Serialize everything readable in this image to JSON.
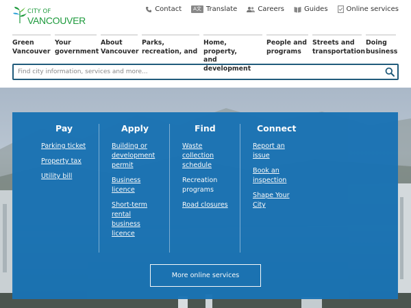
{
  "logo": {
    "line1": "CITY OF",
    "line2": "VANCOUVER"
  },
  "utility": [
    {
      "label": "Contact",
      "icon": "phone-icon"
    },
    {
      "label": "Translate",
      "icon": "translate-icon",
      "badge": "A文"
    },
    {
      "label": "Careers",
      "icon": "people-icon"
    },
    {
      "label": "Guides",
      "icon": "book-icon"
    },
    {
      "label": "Online services",
      "icon": "document-check-icon"
    }
  ],
  "nav": [
    {
      "line1": "Green",
      "line2": "Vancouver"
    },
    {
      "line1": "Your",
      "line2": "government"
    },
    {
      "line1": "About",
      "line2": "Vancouver"
    },
    {
      "line1": "Parks,",
      "line2": "recreation, and"
    },
    {
      "line1": "Home, property,",
      "line2": "and development"
    },
    {
      "line1": "People and",
      "line2": "programs"
    },
    {
      "line1": "Streets and",
      "line2": "transportation"
    },
    {
      "line1": "Doing",
      "line2": "business"
    }
  ],
  "search": {
    "placeholder": "Find city information, services and more..."
  },
  "services": {
    "pay": {
      "heading": "Pay",
      "links": [
        "Parking ticket",
        "Property tax",
        "Utility bill"
      ]
    },
    "apply": {
      "heading": "Apply",
      "links": [
        "Building or development permit",
        "Business licence",
        "Short-term rental business licence"
      ]
    },
    "find": {
      "heading": "Find",
      "links": [
        "Waste collection schedule",
        "Recreation programs",
        "Road closures"
      ]
    },
    "connect": {
      "heading": "Connect",
      "links": [
        "Report an issue",
        "Book an inspection",
        "Shape Your City"
      ]
    },
    "more_button": "More online services"
  },
  "colors": {
    "brand_green": "#1d9a3c",
    "panel_blue": "#1a73b4",
    "search_border": "#1f5a7a"
  }
}
